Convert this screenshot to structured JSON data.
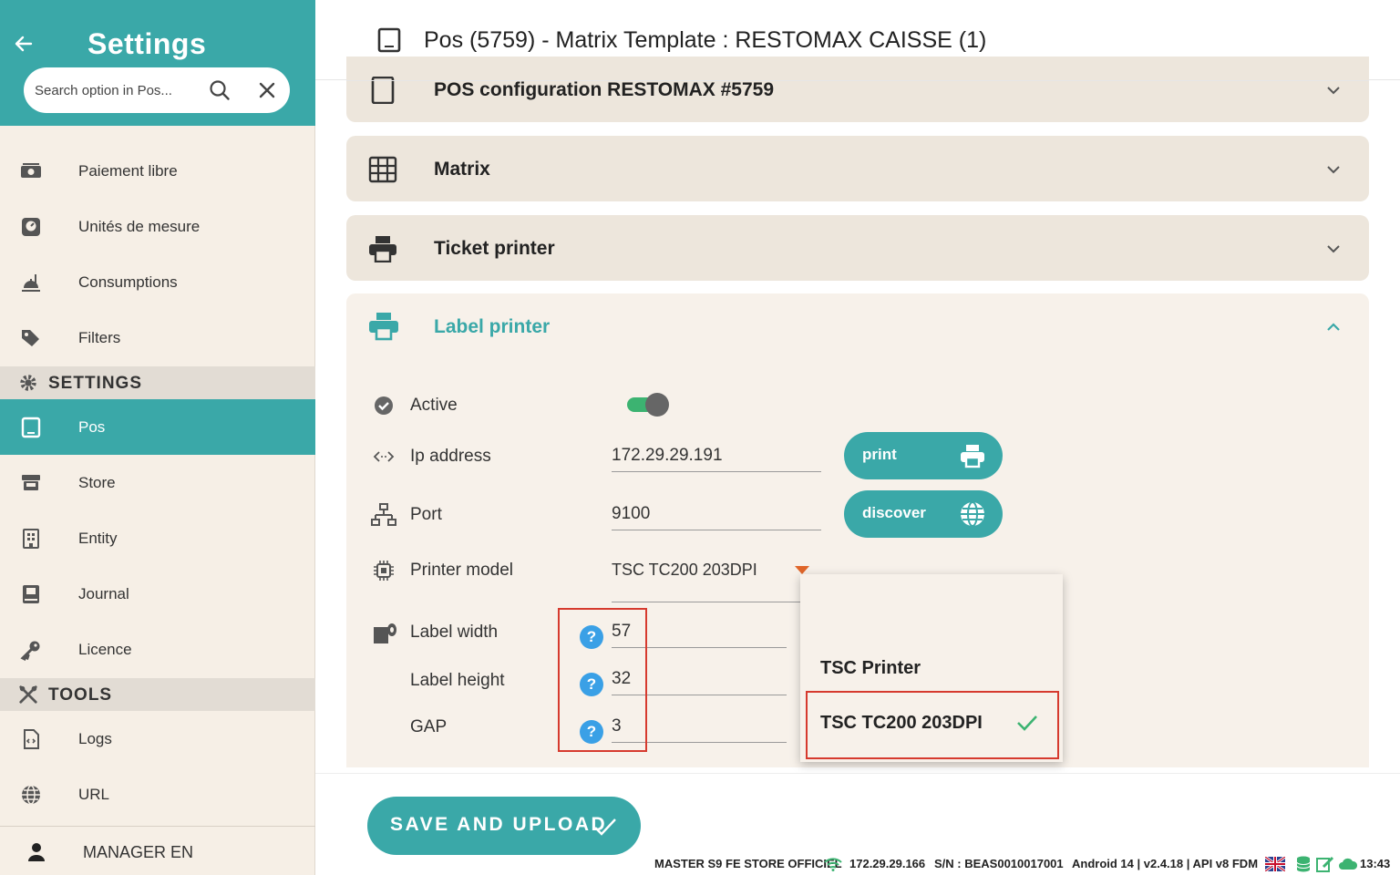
{
  "sidebar": {
    "title": "Settings",
    "search_placeholder": "Search option in Pos...",
    "items_top": [
      {
        "label": "Paiement libre",
        "icon": "money-icon"
      },
      {
        "label": "Unités de mesure",
        "icon": "gauge-icon"
      },
      {
        "label": "Consumptions",
        "icon": "dish-icon"
      },
      {
        "label": "Filters",
        "icon": "tags-icon"
      }
    ],
    "section_settings": "SETTINGS",
    "items_settings": [
      {
        "label": "Pos",
        "icon": "tablet-icon",
        "active": true
      },
      {
        "label": "Store",
        "icon": "store-icon"
      },
      {
        "label": "Entity",
        "icon": "building-icon"
      },
      {
        "label": "Journal",
        "icon": "book-icon"
      },
      {
        "label": "Licence",
        "icon": "key-icon"
      }
    ],
    "section_tools": "TOOLS",
    "items_tools": [
      {
        "label": "Logs",
        "icon": "file-code-icon"
      },
      {
        "label": "URL",
        "icon": "globe-icon"
      }
    ],
    "user_label": "MANAGER EN"
  },
  "header": {
    "title": "Pos (5759) - Matrix Template : RESTOMAX CAISSE (1)"
  },
  "panels": {
    "pos_config": "POS configuration  RESTOMAX #5759",
    "matrix": "Matrix",
    "ticket_printer": "Ticket printer",
    "label_printer": "Label printer"
  },
  "label_printer": {
    "active_label": "Active",
    "active_value": true,
    "ip_label": "Ip address",
    "ip_value": "172.29.29.191",
    "port_label": "Port",
    "port_value": "9100",
    "model_label": "Printer model",
    "model_value": "TSC TC200 203DPI",
    "width_label": "Label width",
    "width_value": "57",
    "height_label": "Label height",
    "height_value": "32",
    "gap_label": "GAP",
    "gap_value": "3",
    "help_glyph": "?",
    "print_button": "print",
    "discover_button": "discover"
  },
  "dropdown": {
    "options": [
      {
        "label": "TSC Printer",
        "selected": false
      },
      {
        "label": "TSC TC200 203DPI",
        "selected": true
      }
    ]
  },
  "footer": {
    "save_button": "SAVE AND UPLOAD",
    "store": "MASTER S9 FE STORE OFFICIEL",
    "ip": "172.29.29.166",
    "serial": "S/N : BEAS0010017001",
    "version": "Android 14  |  v2.4.18 | API v8 FDM",
    "time": "13:43"
  },
  "colors": {
    "accent": "#3aa8a8",
    "sidebar_bg": "#f6efe6",
    "panel_bg": "#ede6dc",
    "highlight_red": "#d63a2e",
    "toggle_on": "#3cb371",
    "help_blue": "#3aa0e6"
  }
}
